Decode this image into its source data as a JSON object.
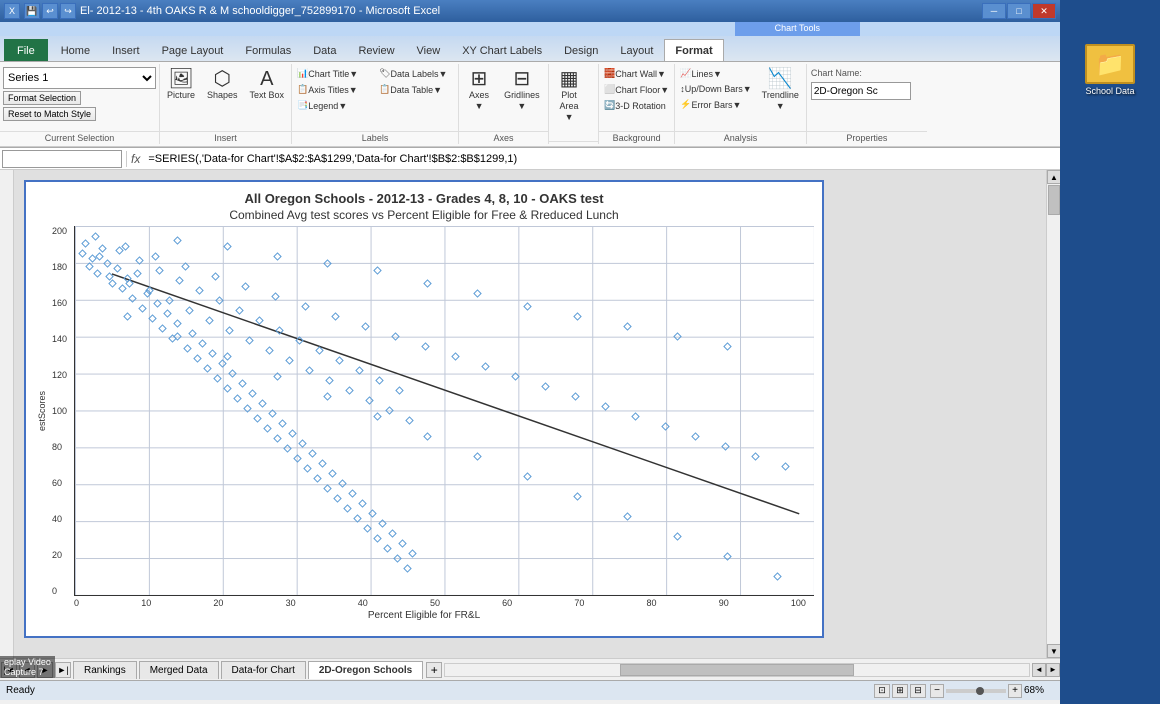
{
  "titleBar": {
    "text": "El- 2012-13 - 4th OAKS R & M schooldigger_752899170 - Microsoft Excel",
    "chartTools": "Chart Tools"
  },
  "ribbon": {
    "tabs": [
      "File",
      "Home",
      "Insert",
      "Page Layout",
      "Formulas",
      "Data",
      "Review",
      "View",
      "XY Chart Labels",
      "Design",
      "Layout",
      "Format"
    ],
    "activeTab": "Format",
    "chartToolsLabel": "Chart Tools"
  },
  "selectionPanel": {
    "dropdownValue": "Series 1",
    "formatBtn": "Format Selection",
    "resetBtn": "Reset to Match Style",
    "groupLabel": "Current Selection"
  },
  "insertGroup": {
    "label": "Insert",
    "buttons": [
      "Picture",
      "Shapes",
      "Text Box"
    ]
  },
  "chartGroup": {
    "label": "Labels",
    "buttons": [
      "Chart Title",
      "Axis Titles",
      "Legend",
      "Data Labels",
      "Data Table"
    ]
  },
  "axesGroup": {
    "label": "Axes",
    "buttons": [
      "Axes",
      "Gridlines"
    ]
  },
  "plotGroup": {
    "label": "",
    "buttons": [
      "Plot Area"
    ]
  },
  "backgroundGroup": {
    "label": "Background",
    "buttons": [
      "Chart Wall",
      "Chart Floor",
      "3-D Rotation"
    ]
  },
  "analysisGroup": {
    "label": "Analysis",
    "buttons": [
      "Lines",
      "Up/Down Bars",
      "Error Bars",
      "Trendline"
    ]
  },
  "propertiesGroup": {
    "label": "Properties",
    "chartNameLabel": "Chart Name:",
    "chartNameValue": "2D-Oregon Sc"
  },
  "formulaBar": {
    "nameBox": "",
    "formula": "=SERIES(,'Data-for Chart'!$A$2:$A$1299,'Data-for Chart'!$B$2:$B$1299,1)"
  },
  "chart": {
    "title": "All Oregon Schools - 2012-13 - Grades 4, 8, 10 - OAKS test",
    "subtitle": "Combined Avg test scores vs Percent Eligible for Free & Rreduced Lunch",
    "xAxisTitle": "Percent Eligible for FR&L",
    "yAxisTitle": "estScores",
    "yAxisLabels": [
      "0",
      "20",
      "40",
      "60",
      "80",
      "100",
      "120",
      "140",
      "160",
      "180",
      "200"
    ],
    "xAxisLabels": [
      "0",
      "10",
      "20",
      "30",
      "40",
      "50",
      "60",
      "70",
      "80",
      "90",
      "100"
    ]
  },
  "sheetTabs": {
    "tabs": [
      "Rankings",
      "Merged Data",
      "Data-for Chart",
      "2D-Oregon Schools"
    ],
    "activeTab": "2D-Oregon Schools"
  },
  "statusBar": {
    "status": "Ready",
    "zoom": "68%"
  },
  "screenRecord": {
    "line1": "eplay Video",
    "line2": "Capture 7"
  },
  "desktopIcon": {
    "label": "School Data"
  },
  "cursor": "🖱️"
}
